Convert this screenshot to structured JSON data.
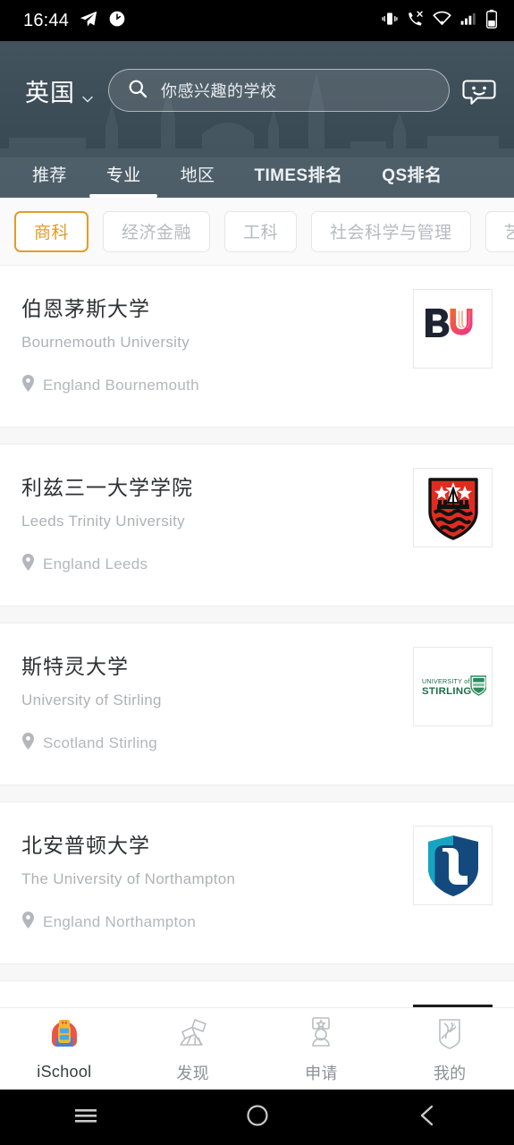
{
  "statusbar": {
    "time": "16:44",
    "left_icons": [
      "telegram-icon",
      "clock-icon"
    ],
    "right_icons": [
      "vibrate-icon",
      "missed-call-icon",
      "wifi-icon",
      "signal-icon",
      "battery-icon"
    ]
  },
  "header": {
    "country": "英国",
    "country_chevron": "chevron-down-icon",
    "search": {
      "placeholder": "你感兴趣的学校",
      "icon": "search-icon",
      "value": ""
    },
    "chat_icon": "chat-smiley-icon",
    "bg_color": "#44555f"
  },
  "tabs": [
    {
      "label": "推荐",
      "active": false,
      "bold": false
    },
    {
      "label": "专业",
      "active": true,
      "bold": false
    },
    {
      "label": "地区",
      "active": false,
      "bold": false
    },
    {
      "label": "TIMES排名",
      "active": false,
      "bold": true
    },
    {
      "label": "QS排名",
      "active": false,
      "bold": true
    }
  ],
  "chips": {
    "active_color": "#e39b2b",
    "items": [
      {
        "label": "商科",
        "active": true
      },
      {
        "label": "经济金融",
        "active": false
      },
      {
        "label": "工科",
        "active": false
      },
      {
        "label": "社会科学与管理",
        "active": false
      },
      {
        "label": "艺术",
        "active": false
      }
    ]
  },
  "schools": [
    {
      "cn_name": "伯恩茅斯大学",
      "en_name": "Bournemouth University",
      "location": "England Bournemouth",
      "location_icon": "map-pin-icon",
      "logo": "bournemouth-university-logo"
    },
    {
      "cn_name": "利兹三一大学学院",
      "en_name": "Leeds Trinity University",
      "location": "England Leeds",
      "location_icon": "map-pin-icon",
      "logo": "leeds-trinity-university-logo"
    },
    {
      "cn_name": "斯特灵大学",
      "en_name": "University of Stirling",
      "location": "Scotland Stirling",
      "location_icon": "map-pin-icon",
      "logo": "university-of-stirling-logo"
    },
    {
      "cn_name": "北安普顿大学",
      "en_name": "The University of Northampton",
      "location": "England Northampton",
      "location_icon": "map-pin-icon",
      "logo": "university-of-northampton-logo"
    }
  ],
  "stirling_logo_text": {
    "line1": "UNIVERSITY of",
    "line2": "STIRLING"
  },
  "bottomnav": [
    {
      "label": "iSchool",
      "icon": "backpack-icon",
      "active": true
    },
    {
      "label": "发现",
      "icon": "telescope-icon",
      "active": false
    },
    {
      "label": "申请",
      "icon": "certificate-icon",
      "active": false
    },
    {
      "label": "我的",
      "icon": "profile-icon",
      "active": false
    }
  ],
  "androidnav": [
    {
      "icon": "menu-icon"
    },
    {
      "icon": "home-circle-icon"
    },
    {
      "icon": "back-chevron-icon"
    }
  ]
}
